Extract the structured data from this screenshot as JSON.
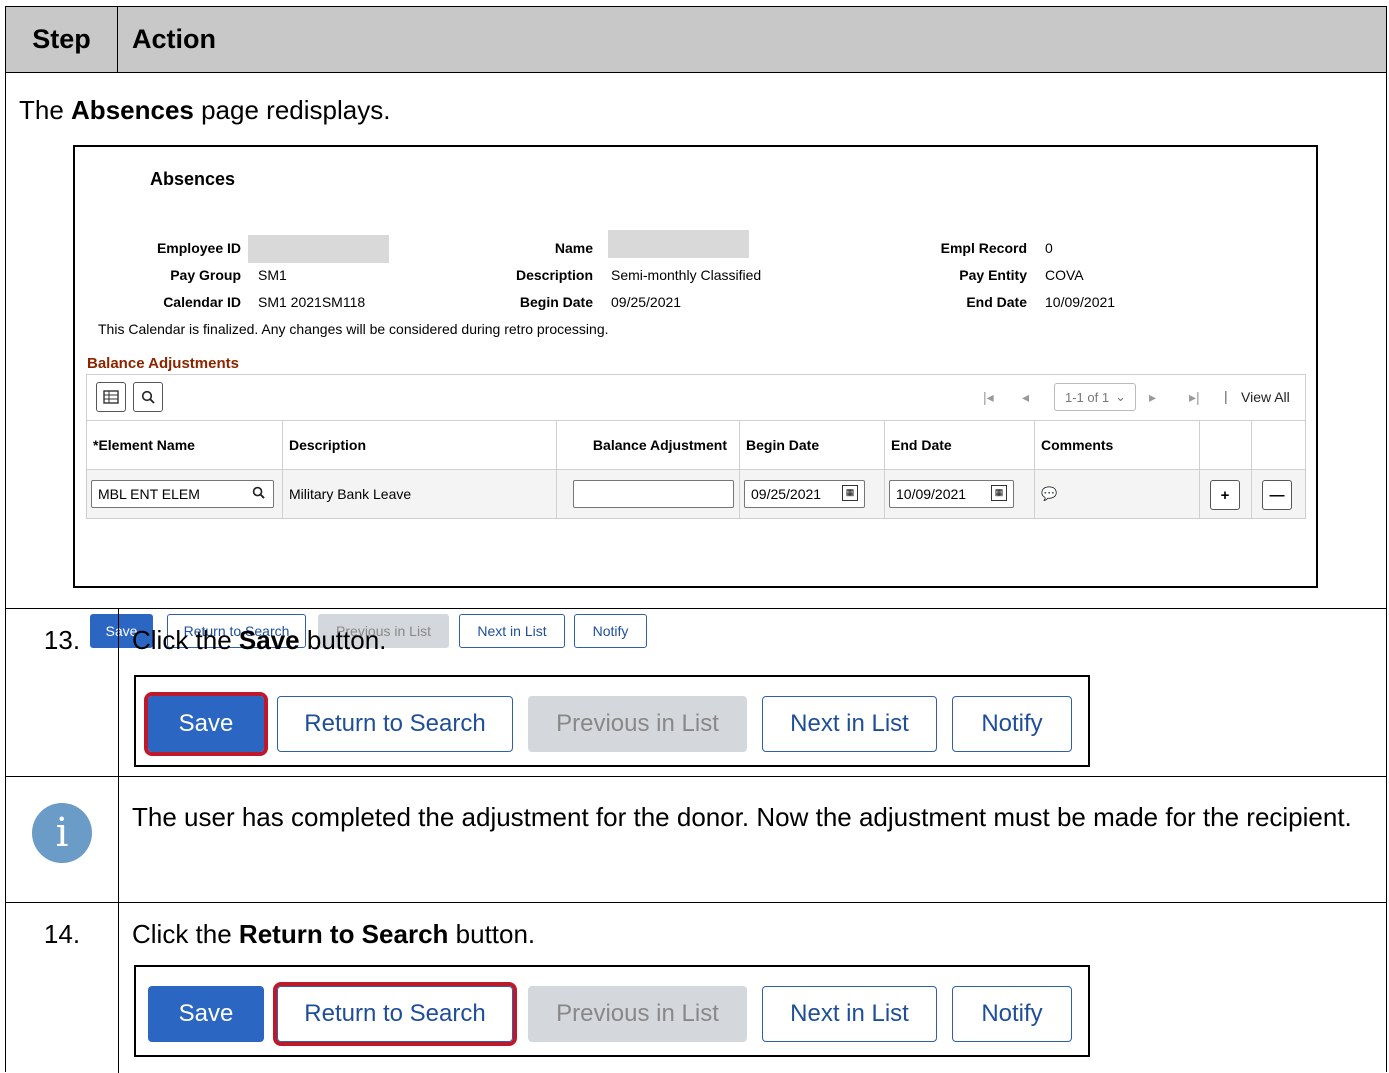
{
  "header": {
    "step": "Step",
    "action": "Action"
  },
  "intro": {
    "prefix": "The ",
    "bold": "Absences",
    "suffix": " page redisplays."
  },
  "absences": {
    "title": "Absences",
    "fields": {
      "employee_id_label": "Employee ID",
      "name_label": "Name",
      "empl_record_label": "Empl Record",
      "empl_record": "0",
      "pay_group_label": "Pay Group",
      "pay_group": "SM1",
      "description_label": "Description",
      "description": "Semi-monthly Classified",
      "pay_entity_label": "Pay Entity",
      "pay_entity": "COVA",
      "calendar_id_label": "Calendar ID",
      "calendar_id": "SM1 2021SM118",
      "begin_date_label": "Begin Date",
      "begin_date": "09/25/2021",
      "end_date_label": "End Date",
      "end_date": "10/09/2021"
    },
    "notice": "This Calendar is finalized. Any changes will be considered during retro processing.",
    "section_title": "Balance Adjustments",
    "pager": {
      "range": "1-1 of 1",
      "view_all": "View All"
    },
    "columns": [
      "*Element Name",
      "Description",
      "Balance Adjustment",
      "Begin Date",
      "End Date",
      "Comments"
    ],
    "row": {
      "element_name": "MBL ENT ELEM",
      "description": "Military Bank Leave",
      "balance_adjustment": "",
      "begin_date": "09/25/2021",
      "end_date": "10/09/2021"
    },
    "buttons": {
      "save": "Save",
      "return": "Return to Search",
      "previous": "Previous in List",
      "next": "Next in List",
      "notify": "Notify"
    }
  },
  "step13": {
    "num": "13.",
    "prefix": "Click the ",
    "bold": "Save",
    "suffix": " button."
  },
  "info": {
    "text": "The user has completed the adjustment for the donor. Now the adjustment must be made for the recipient."
  },
  "step14": {
    "num": "14.",
    "prefix": "Click the ",
    "bold": "Return to Search",
    "suffix": " button."
  },
  "buttons": {
    "save": "Save",
    "return": "Return to Search",
    "previous": "Previous in List",
    "next": "Next in List",
    "notify": "Notify"
  },
  "colors": {
    "primary": "#2b66c2",
    "highlight": "#c0182b",
    "section_title": "#8b2500",
    "info_icon": "#6b9bc7"
  },
  "icons": [
    "grid-icon",
    "search-icon",
    "calendar-icon",
    "comment-icon",
    "add-row-icon",
    "delete-row-icon",
    "info-icon"
  ]
}
